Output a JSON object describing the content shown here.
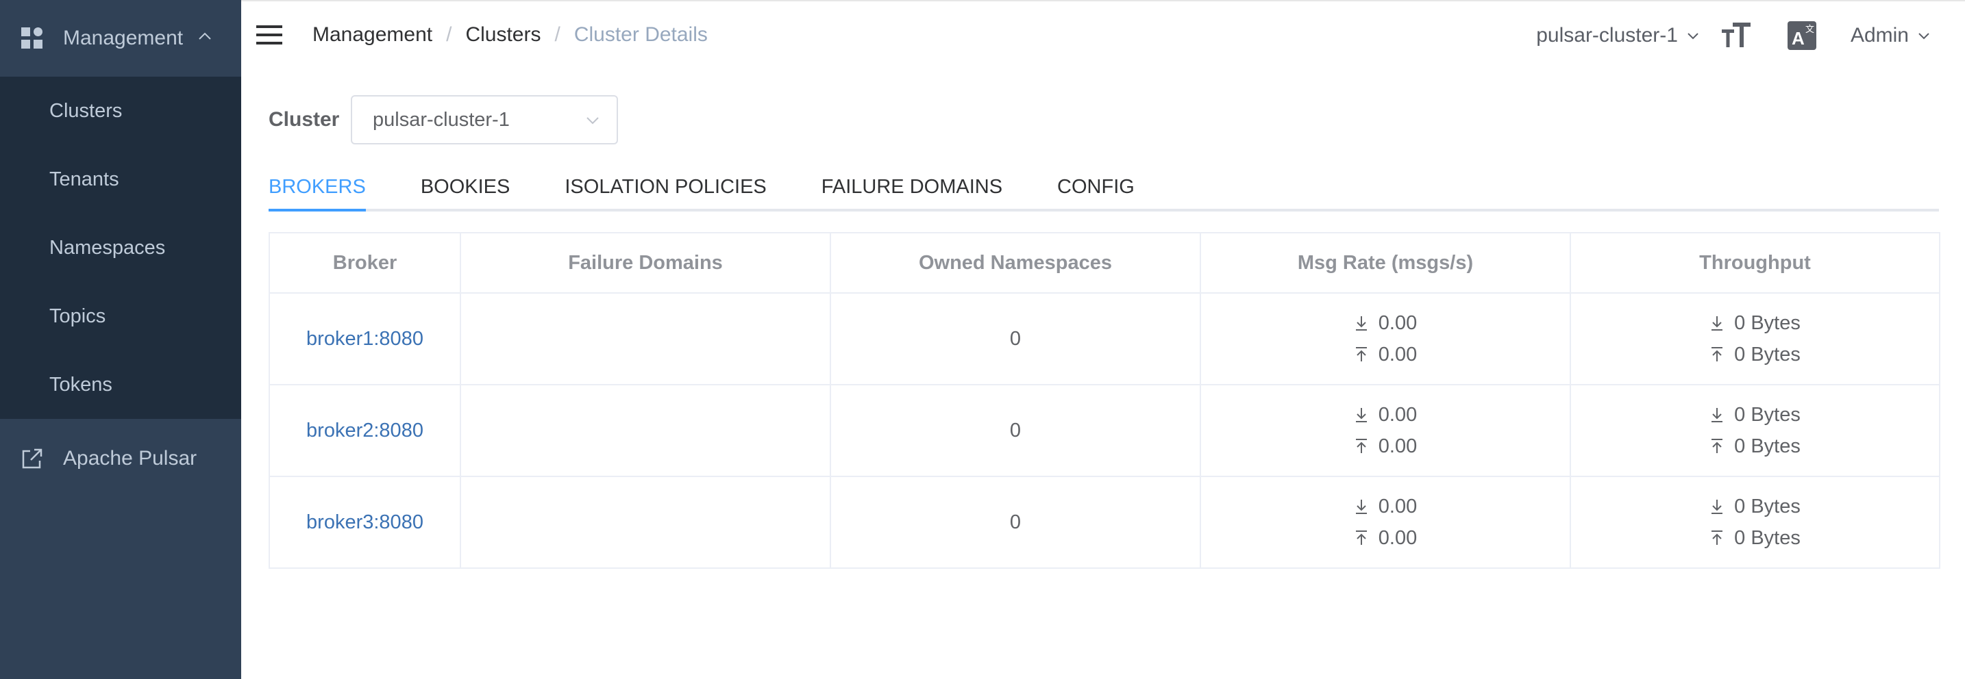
{
  "sidebar": {
    "section_label": "Management",
    "items": [
      {
        "label": "Clusters"
      },
      {
        "label": "Tenants"
      },
      {
        "label": "Namespaces"
      },
      {
        "label": "Topics"
      },
      {
        "label": "Tokens"
      }
    ],
    "external_label": "Apache Pulsar",
    "colors": {
      "background": "#304156",
      "submenu_background": "#1f2d3d",
      "text": "#bfcbd9"
    }
  },
  "topbar": {
    "breadcrumb": [
      "Management",
      "Clusters",
      "Cluster Details"
    ],
    "separator": "/",
    "cluster_switch": "pulsar-cluster-1",
    "user": "Admin",
    "icons": [
      "hamburger-icon",
      "font-size-icon",
      "translate-icon"
    ]
  },
  "main": {
    "cluster_label": "Cluster",
    "cluster_select_value": "pulsar-cluster-1",
    "tabs": [
      {
        "label": "BROKERS",
        "active": true
      },
      {
        "label": "BOOKIES",
        "active": false
      },
      {
        "label": "ISOLATION POLICIES",
        "active": false
      },
      {
        "label": "FAILURE DOMAINS",
        "active": false
      },
      {
        "label": "CONFIG",
        "active": false
      }
    ],
    "table": {
      "headers": [
        "Broker",
        "Failure Domains",
        "Owned Namespaces",
        "Msg Rate (msgs/s)",
        "Throughput"
      ],
      "rows": [
        {
          "broker": "broker1:8080",
          "failure_domains": "",
          "owned_namespaces": "0",
          "msg_rate_in": "0.00",
          "msg_rate_out": "0.00",
          "throughput_in": "0 Bytes",
          "throughput_out": "0 Bytes"
        },
        {
          "broker": "broker2:8080",
          "failure_domains": "",
          "owned_namespaces": "0",
          "msg_rate_in": "0.00",
          "msg_rate_out": "0.00",
          "throughput_in": "0 Bytes",
          "throughput_out": "0 Bytes"
        },
        {
          "broker": "broker3:8080",
          "failure_domains": "",
          "owned_namespaces": "0",
          "msg_rate_in": "0.00",
          "msg_rate_out": "0.00",
          "throughput_in": "0 Bytes",
          "throughput_out": "0 Bytes"
        }
      ]
    },
    "colors": {
      "accent": "#409eff",
      "link": "#3b72b4"
    }
  }
}
